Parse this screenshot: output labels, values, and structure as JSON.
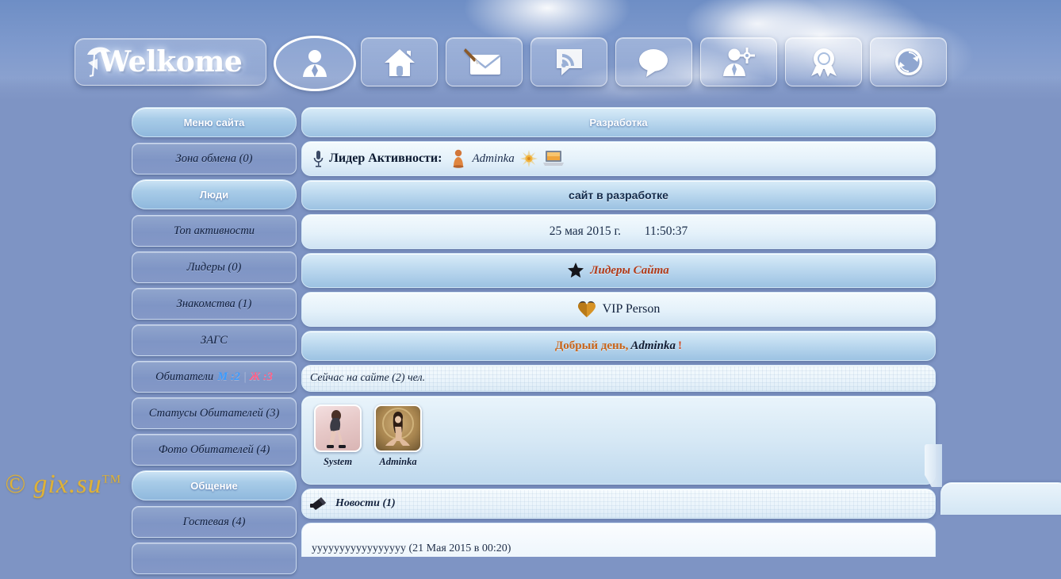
{
  "site": {
    "logo_text": "Welkome",
    "watermark": "© gix.su",
    "watermark_tm": "TM"
  },
  "topnav": {
    "items": [
      {
        "name": "profile",
        "icon": "user-avatar-icon",
        "active": true
      },
      {
        "name": "home",
        "icon": "home-icon",
        "active": false
      },
      {
        "name": "mail",
        "icon": "envelope-pen-icon",
        "active": false
      },
      {
        "name": "feed",
        "icon": "rss-bubble-icon",
        "active": false
      },
      {
        "name": "chat",
        "icon": "speech-bubble-icon",
        "active": false
      },
      {
        "name": "friends",
        "icon": "user-settings-icon",
        "active": false
      },
      {
        "name": "awards",
        "icon": "award-ribbon-icon",
        "active": false
      },
      {
        "name": "refresh",
        "icon": "refresh-icon",
        "active": false
      }
    ]
  },
  "sidebar": {
    "groups": [
      {
        "header": "Меню сайта",
        "items": [
          {
            "label": "Зона обмена (0)"
          }
        ]
      },
      {
        "header": "Люди",
        "items": [
          {
            "label": "Топ активности"
          },
          {
            "label": "Лидеры (0)"
          },
          {
            "label": "Знакомства (1)"
          },
          {
            "label": "ЗАГС"
          },
          {
            "label": "Обитатели",
            "male_label": "М :2",
            "female_label": "Ж :3",
            "has_counts": true
          },
          {
            "label": "Статусы Обитателей (3)"
          },
          {
            "label": "Фото Обитателей (4)"
          }
        ]
      },
      {
        "header": "Общение",
        "items": [
          {
            "label": "Гостевая (4)"
          }
        ]
      }
    ]
  },
  "main": {
    "page_title": "Разработка",
    "activity_leader": {
      "icon": "microphone-icon",
      "label": "Лидер Активности:",
      "medal_icon": "trophy-icon",
      "nick": "Adminka",
      "sun_icon": "sun-star-icon",
      "laptop_icon": "laptop-icon"
    },
    "status_banner": "сайт в разработке",
    "date": "25 мая 2015 г.",
    "time": "11:50:37",
    "leaders_row": {
      "icon": "star-icon",
      "label": "Лидеры Сайта"
    },
    "vip_row": {
      "icon": "heart-icon",
      "label": "VIP Person"
    },
    "greeting": {
      "text": "Добрый день,",
      "name": "Adminka",
      "mark": "!"
    },
    "online_label": "Сейчас на сайте (2) чел.",
    "online_users": [
      {
        "name": "System",
        "avatar": "female-standing-photo"
      },
      {
        "name": "Adminka",
        "avatar": "female-seated-photo"
      }
    ],
    "news": {
      "icon": "megaphone-icon",
      "header": "Новости (1)",
      "entry": "ууууууууууууууууу (21 Мая 2015 в 00:20)"
    }
  },
  "colors": {
    "page_background": "#7e94c4",
    "panel_light": "#e4f1fa",
    "panel_header": "#bcd9ef",
    "accent_red": "#b23a18",
    "accent_orange": "#c8651b",
    "male_blue": "#3a9bff",
    "female_pink": "#ff5f86",
    "watermark_gold": "#e8b52a"
  }
}
